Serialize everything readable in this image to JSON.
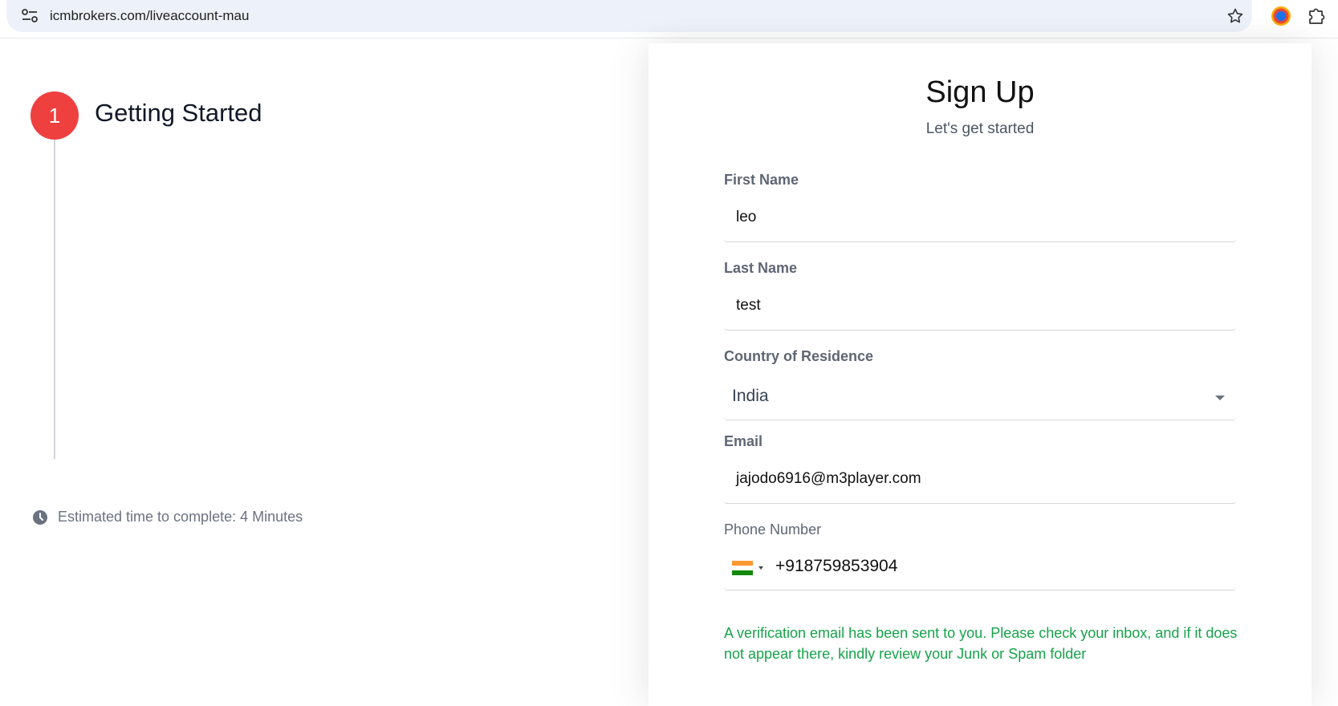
{
  "browser": {
    "url": "icmbrokers.com/liveaccount-mau",
    "icons": [
      "site-settings-icon",
      "bookmark-star-icon",
      "extension-color-icon",
      "extensions-puzzle-icon"
    ]
  },
  "progress": {
    "step_number": "1",
    "step_title": "Getting Started",
    "estimate": "Estimated time to complete: 4 Minutes"
  },
  "form": {
    "title": "Sign Up",
    "subtitle": "Let's get started",
    "first_name": {
      "label": "First Name",
      "value": "leo"
    },
    "last_name": {
      "label": "Last Name",
      "value": "test"
    },
    "country": {
      "label": "Country of Residence",
      "value": "India"
    },
    "email": {
      "label": "Email",
      "value": "jajodo6916@m3player.com"
    },
    "phone": {
      "label": "Phone Number",
      "value": "+918759853904",
      "flag": "india-flag-icon"
    },
    "notice": "A verification email has been sent to you. Please check your inbox, and if it does not appear there, kindly review your Junk or Spam folder"
  },
  "colors": {
    "accent": "#ef4040",
    "notice": "#16a34a",
    "omnibox": "#edf2fa"
  }
}
